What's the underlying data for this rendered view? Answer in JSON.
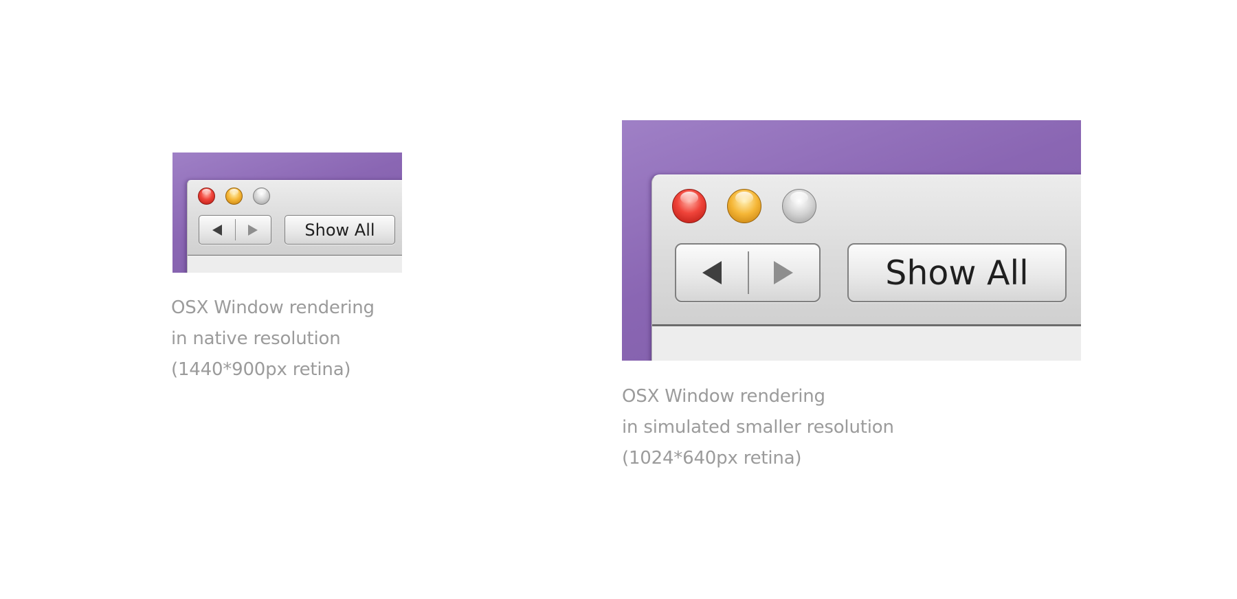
{
  "panels": [
    {
      "window": {
        "traffic_lights": [
          "close",
          "minimize",
          "zoom"
        ],
        "nav_icons": [
          "back-arrow-icon",
          "forward-arrow-icon"
        ],
        "show_all_label": "Show All"
      },
      "caption": [
        "OSX Window rendering",
        "in native resolution",
        "(1440*900px retina)"
      ]
    },
    {
      "window": {
        "traffic_lights": [
          "close",
          "minimize",
          "zoom"
        ],
        "nav_icons": [
          "back-arrow-icon",
          "forward-arrow-icon"
        ],
        "show_all_label": "Show All"
      },
      "caption": [
        "OSX Window rendering",
        "in simulated smaller resolution",
        "(1024*640px retina)"
      ]
    }
  ],
  "colors": {
    "desktop_purple": "#8a66b3",
    "window_gray": "#dcdcdc",
    "caption_text": "#9b9b9b",
    "close_red": "#f0443a",
    "minimize_yellow": "#f5b636",
    "zoom_gray": "#c8c8c8"
  }
}
